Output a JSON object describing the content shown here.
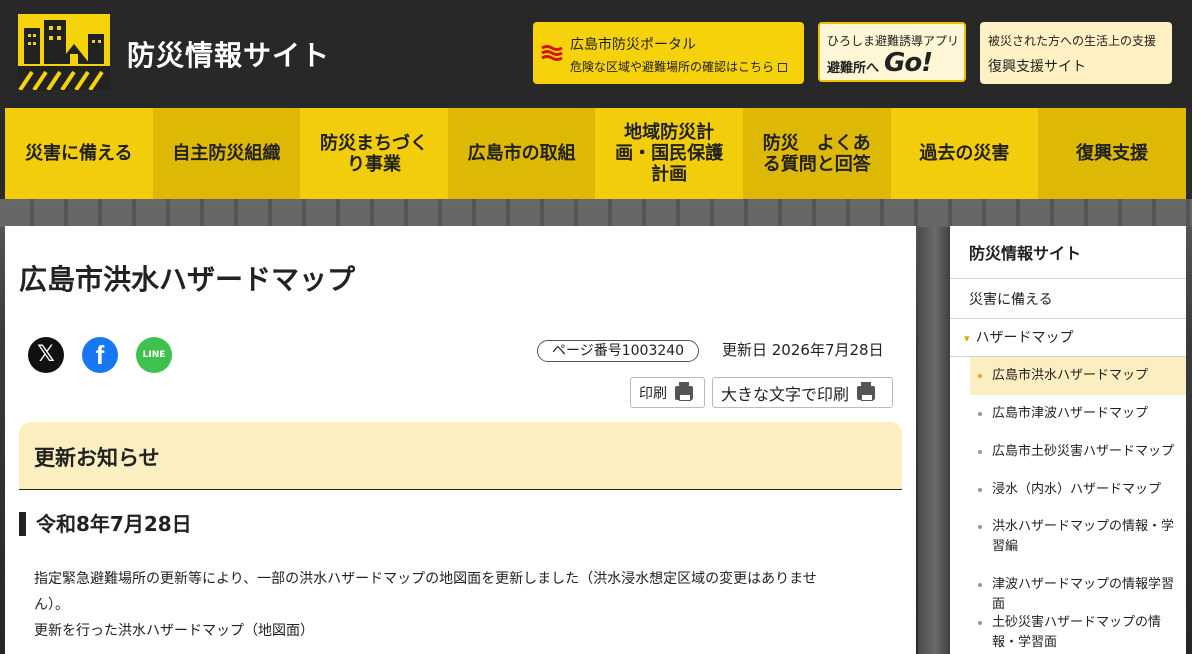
{
  "header": {
    "site_title": "防災情報サイト",
    "portal": {
      "line1": "広島市防災ポータル",
      "line2": "危険な区域や避難場所の確認はこちら"
    },
    "app": {
      "line1": "ひろしま避難誘導アプリ",
      "line2": "避難所へ",
      "go": "Go!"
    },
    "recovery": {
      "line1": "被災された方への生活上の支援",
      "line2": "復興支援サイト"
    }
  },
  "nav": {
    "items": [
      "災害に備える",
      "自主防災組織",
      "防災まちづくり事業",
      "広島市の取組",
      "地域防災計画・国民保護計画",
      "防災　よくある質問と回答",
      "過去の災害",
      "復興支援"
    ]
  },
  "main": {
    "title": "広島市洪水ハザードマップ",
    "social": {
      "x": "𝕏",
      "facebook": "f",
      "line": "LINE"
    },
    "page_number": "ページ番号1003240",
    "updated": "更新日  2026年7月28日",
    "print": "印刷",
    "print_large": "大きな文字で印刷",
    "notice_title": "更新お知らせ",
    "date_heading": "令和8年7月28日",
    "body_line1": "指定緊急避難場所の更新等により、一部の洪水ハザードマップの地図面を更新しました（洪水浸水想定区域の変更はありませ",
    "body_line2": "ん）。",
    "body_line3": "更新を行った洪水ハザードマップ（地図面）"
  },
  "sidebar": {
    "title": "防災情報サイト",
    "level1": "災害に備える",
    "level2": "ハザードマップ",
    "items": [
      "広島市洪水ハザードマップ",
      "広島市津波ハザードマップ",
      "広島市土砂災害ハザードマップ",
      "浸水（内水）ハザードマップ",
      "洪水ハザードマップの情報・学習編",
      "津波ハザードマップの情報学習面",
      "土砂災害ハザードマップの情報・学習面"
    ]
  },
  "colors": {
    "accent": "#f2cd0b",
    "accent_dark": "#ddb906",
    "header_bg": "#282828",
    "notice_bg": "#fbeec0"
  }
}
